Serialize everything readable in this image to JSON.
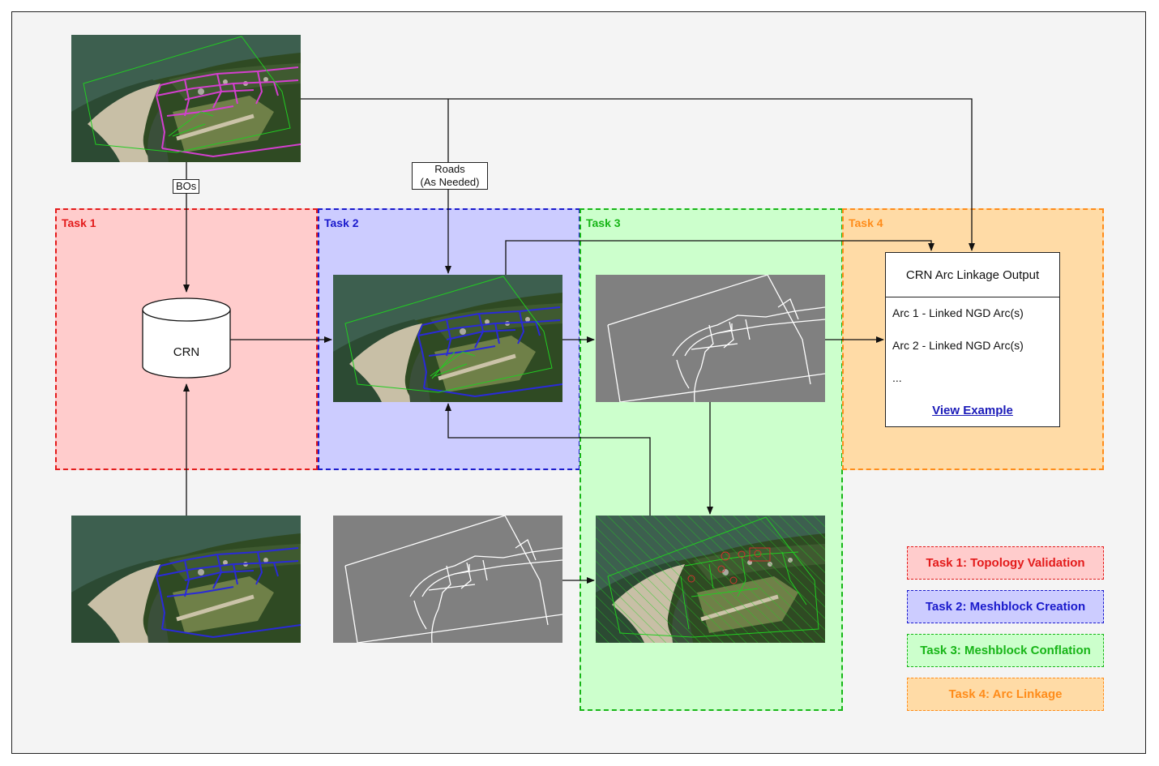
{
  "tasks": {
    "task1": "Task 1",
    "task2": "Task 2",
    "task3": "Task 3",
    "task4": "Task 4"
  },
  "edge_labels": {
    "bos": "BOs",
    "roads_line1": "Roads",
    "roads_line2": "(As Needed)"
  },
  "crn_label": "CRN",
  "output": {
    "title": "CRN Arc Linkage Output",
    "row1": "Arc 1 - Linked NGD Arc(s)",
    "row2": "Arc 2 - Linked NGD Arc(s)",
    "row3": "...",
    "link": "View Example"
  },
  "legend": [
    {
      "label": "Task 1: Topology Validation",
      "color": "#e31b1b",
      "fill": "#ffcccc"
    },
    {
      "label": "Task 2: Meshblock Creation",
      "color": "#1a1acc",
      "fill": "#ccccff"
    },
    {
      "label": "Task 3: Meshblock Conflation",
      "color": "#17b517",
      "fill": "#ccffcc"
    },
    {
      "label": "Task 4: Arc Linkage",
      "color": "#ff8c1a",
      "fill": "#ffdba6"
    }
  ],
  "colors": {
    "river": "#3d5f4f",
    "forest": "#2f4a23",
    "sandbar": "#c8bfa6",
    "field": "#7d8f56",
    "gray_map": "#808080",
    "roads_magenta": "#d43fcf",
    "roads_blue": "#2a2ad8",
    "meshblock_green": "#22cc22"
  }
}
